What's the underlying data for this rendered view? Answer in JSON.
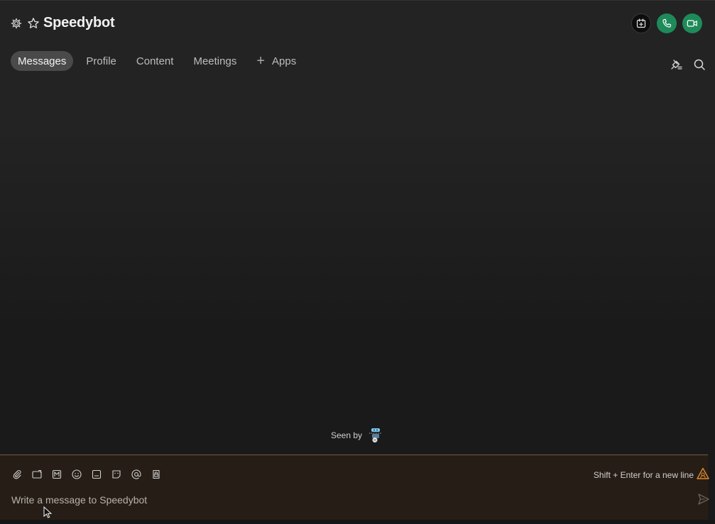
{
  "header": {
    "title": "Speedybot",
    "settings_icon": "gear-icon",
    "favorite_icon": "star-icon",
    "actions": [
      {
        "name": "schedule-meeting",
        "icon": "calendar-plus-icon"
      },
      {
        "name": "audio-call",
        "icon": "phone-icon",
        "color": "#1e8a5a"
      },
      {
        "name": "video-call",
        "icon": "video-icon",
        "color": "#1e8a5a"
      }
    ]
  },
  "tabs": [
    {
      "label": "Messages",
      "active": true
    },
    {
      "label": "Profile"
    },
    {
      "label": "Content"
    },
    {
      "label": "Meetings"
    },
    {
      "label": "Apps",
      "icon": "plus-icon"
    }
  ],
  "conversation": {
    "seen_by_label": "Seen by",
    "seen_by_avatar": "bot-avatar"
  },
  "composer": {
    "placeholder": "Write a message to Speedybot",
    "hint": "Shift + Enter for a new line",
    "toolbar_icons": [
      "paperclip-icon",
      "screen-share-icon",
      "markdown-icon",
      "emoji-icon",
      "gif-icon",
      "sticker-icon",
      "mention-icon",
      "lock-icon"
    ],
    "accent_color": "#e08a2c"
  }
}
